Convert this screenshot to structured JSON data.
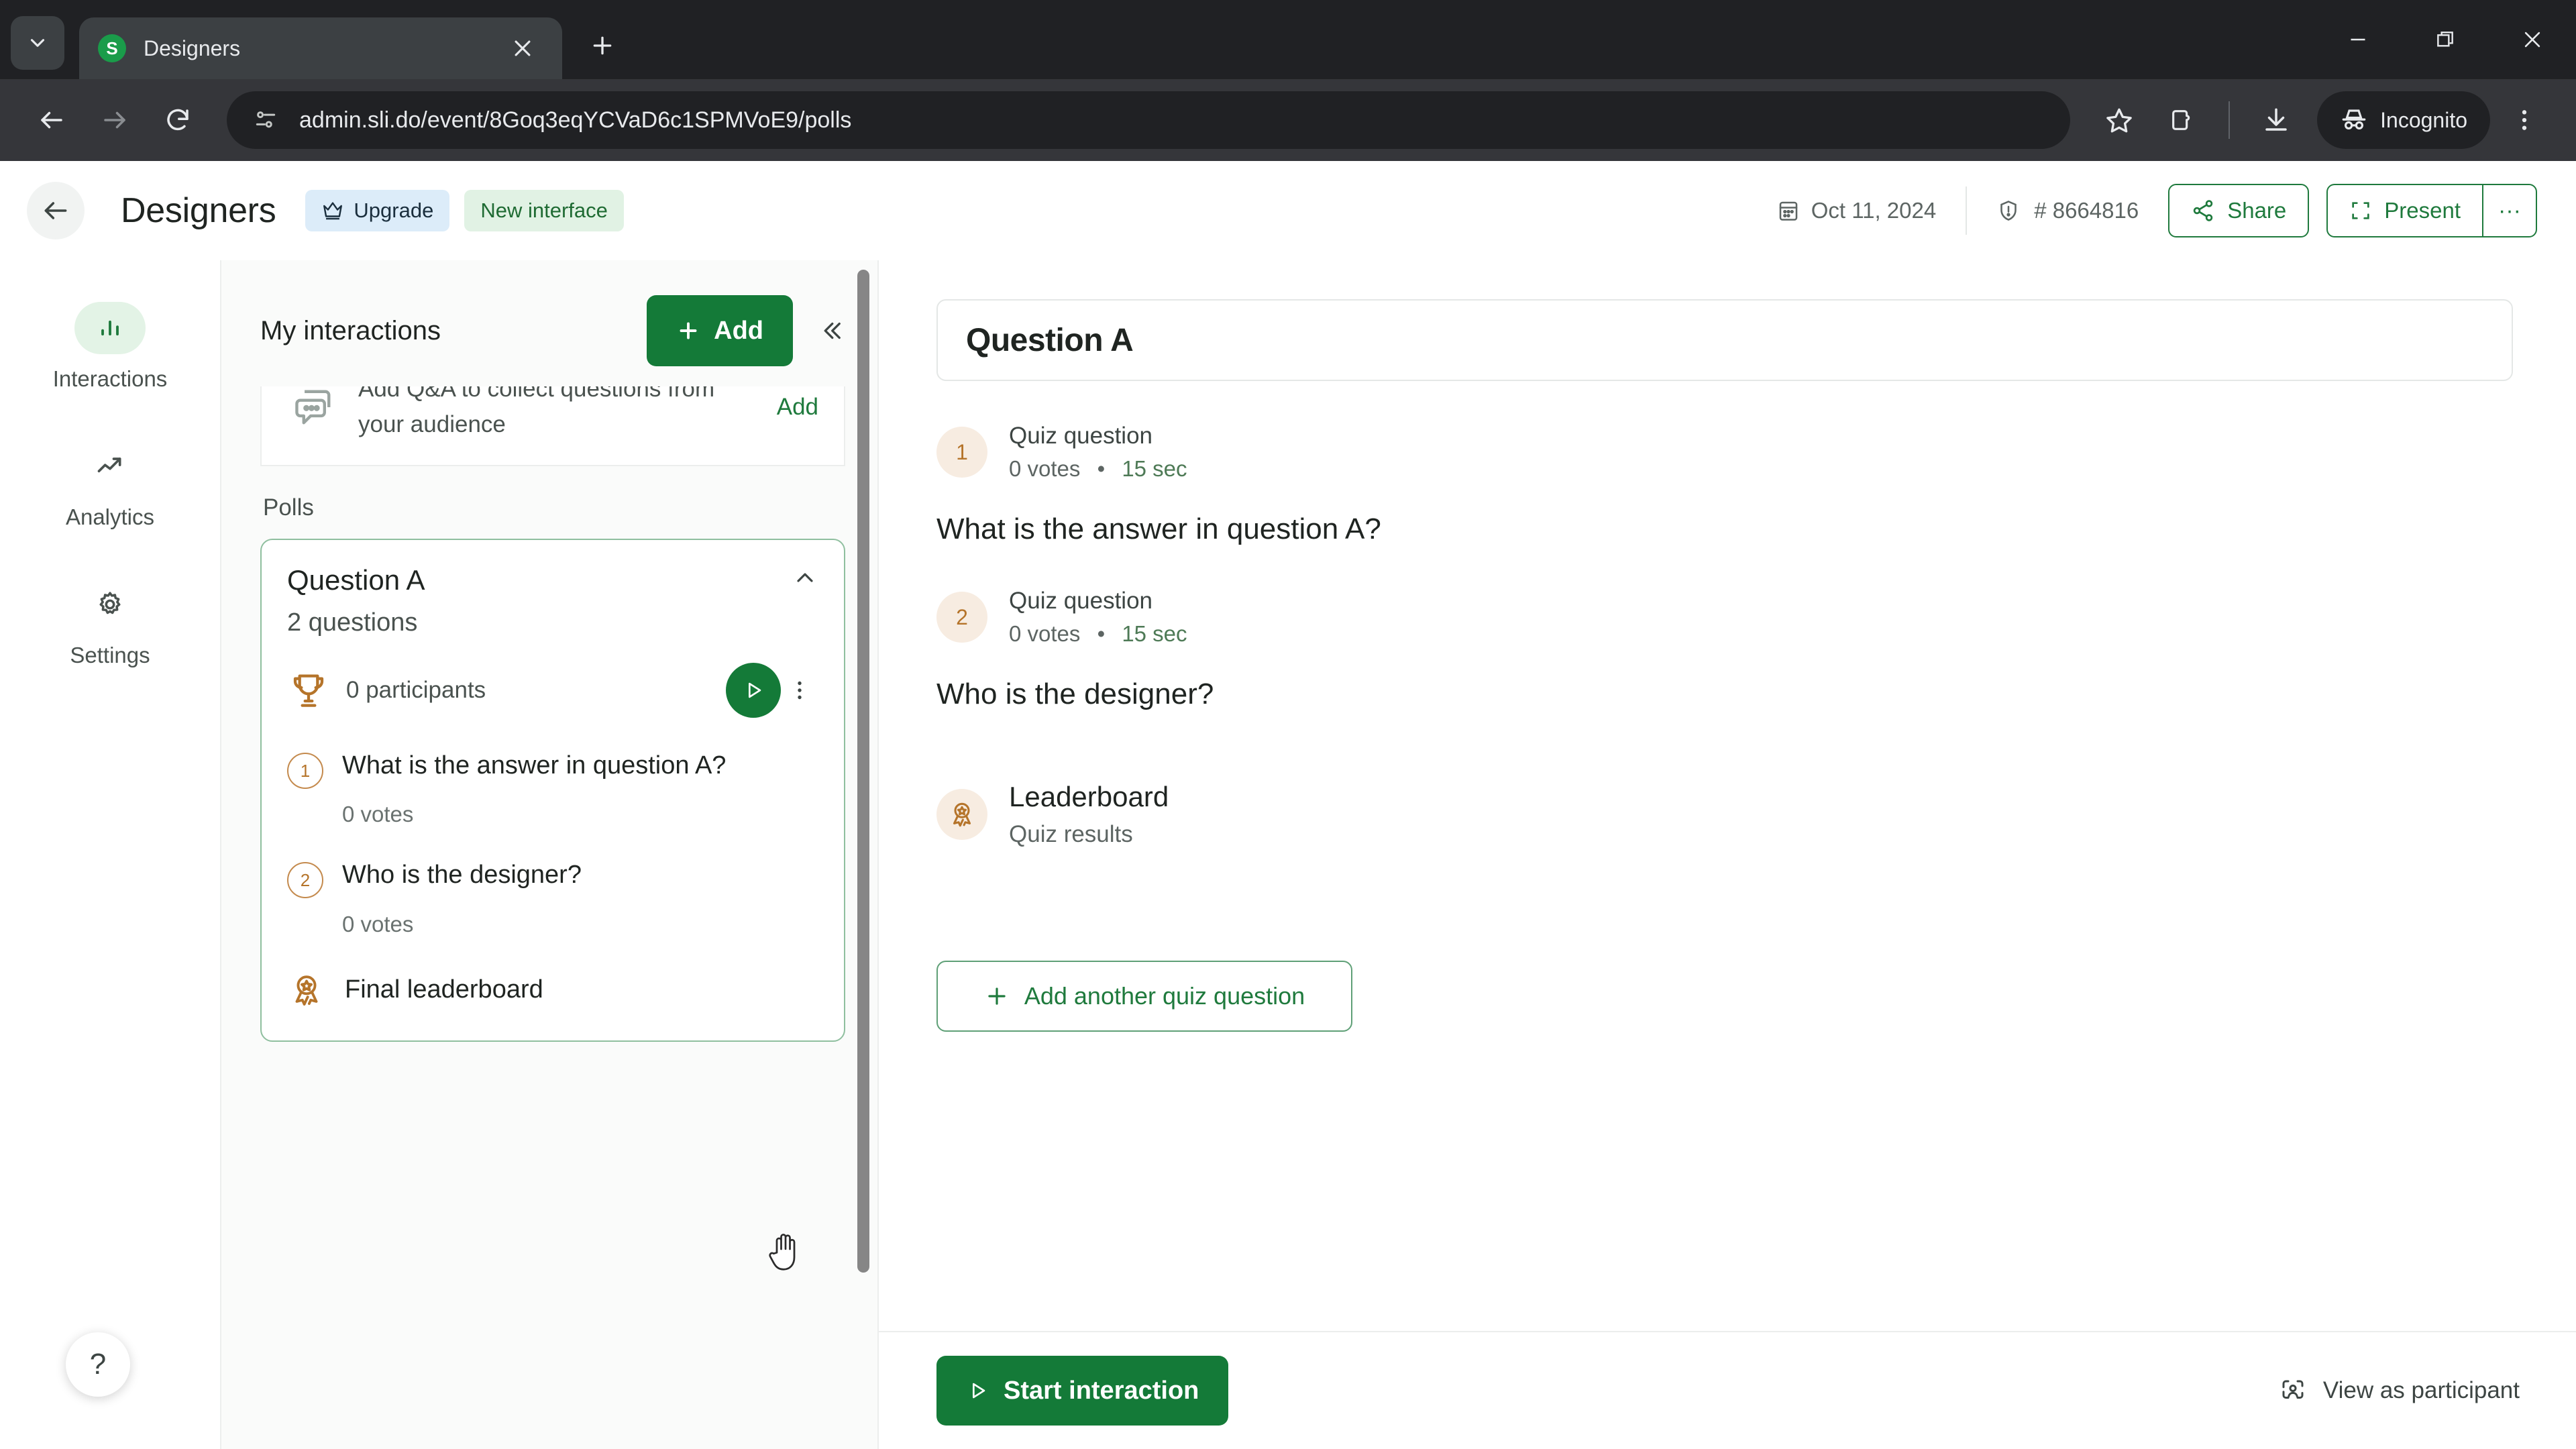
{
  "browser": {
    "tab": {
      "title": "Designers",
      "favicon_letter": "S",
      "favicon_name": "slido-favicon"
    },
    "new_tab_label": "+",
    "url": "admin.sli.do/event/8Goq3eqYCVaD6c1SPMVoE9/polls",
    "profile_label": "Incognito",
    "icons": {
      "tab_search": "chevron-down-icon",
      "back": "back-arrow-icon",
      "forward": "forward-arrow-icon",
      "reload": "reload-icon",
      "site_info": "page-settings-icon",
      "bookmark": "star-icon",
      "extensions": "extensions-icon",
      "downloads": "download-icon",
      "menu": "three-dot-menu-icon",
      "minimize": "minimize-icon",
      "maximize": "maximize-icon",
      "close": "close-icon"
    }
  },
  "app_header": {
    "back_label": "←",
    "title": "Designers",
    "upgrade_label": "Upgrade",
    "new_interface_label": "New interface",
    "date": "Oct 11, 2024",
    "event_code": "# 8664816",
    "share_label": "Share",
    "present_label": "Present",
    "more_label": "···"
  },
  "rail": {
    "items": [
      {
        "label": "Interactions",
        "icon": "bar-chart-icon",
        "active": true
      },
      {
        "label": "Analytics",
        "icon": "trend-up-icon",
        "active": false
      },
      {
        "label": "Settings",
        "icon": "gear-icon",
        "active": false
      }
    ],
    "help_label": "?"
  },
  "panel": {
    "title": "My interactions",
    "add_label": "Add",
    "collapse_icon": "double-chevron-left-icon",
    "qa_card": {
      "text": "Add Q&A to collect questions from your audience",
      "action_label": "Add",
      "icon": "chat-bubble-icon"
    },
    "section_label": "Polls",
    "poll_card": {
      "name": "Question A",
      "subtitle": "2 questions",
      "participants": "0 participants",
      "trophy_icon": "trophy-icon",
      "play_icon": "play-icon",
      "kebab_icon": "vertical-dots-icon",
      "questions": [
        {
          "num": "1",
          "text": "What is the answer in question A?",
          "votes": "0 votes"
        },
        {
          "num": "2",
          "text": "Who is the designer?",
          "votes": "0 votes"
        }
      ],
      "leaderboard_label": "Final leaderboard",
      "leaderboard_icon": "award-ribbon-icon"
    }
  },
  "main": {
    "title_value": "Question A",
    "title_placeholder": "Question A",
    "items": [
      {
        "badge": "1",
        "kind": "Quiz question",
        "votes": "0 votes",
        "separator": "•",
        "duration": "15 sec",
        "question": "What is the answer in question A?"
      },
      {
        "badge": "2",
        "kind": "Quiz question",
        "votes": "0 votes",
        "separator": "•",
        "duration": "15 sec",
        "question": "Who is the designer?"
      }
    ],
    "leaderboard": {
      "title": "Leaderboard",
      "subtitle": "Quiz results",
      "icon": "award-ribbon-icon"
    },
    "add_question_label": "Add another quiz question",
    "start_label": "Start interaction",
    "view_as_participant_label": "View as participant"
  },
  "colors": {
    "brand_green": "#147a38",
    "outline_green": "#1f7a3d",
    "accent_orange": "#b5742a",
    "upgrade_blue_bg": "#dcecf9",
    "new_interface_bg": "#e1f2e4"
  }
}
